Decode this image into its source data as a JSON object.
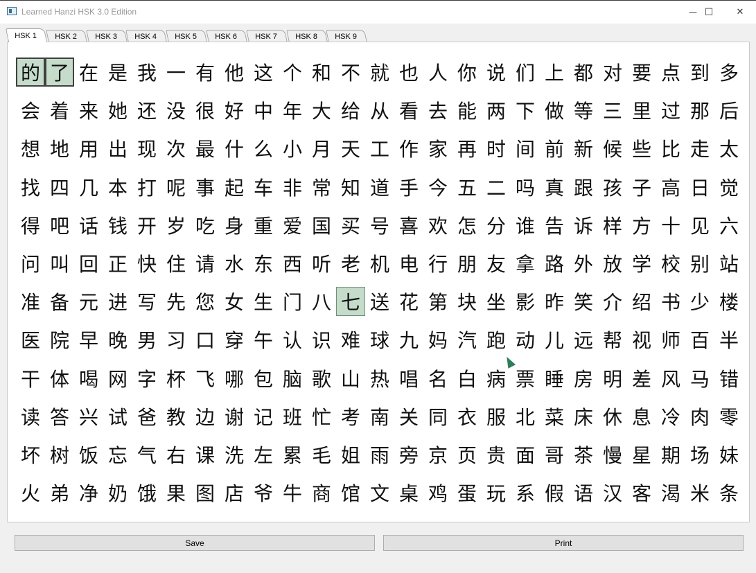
{
  "window": {
    "title": "Learned Hanzi HSK 3.0 Edition",
    "controls": {
      "minimize": "—",
      "maximize": "☐",
      "close": "✕"
    }
  },
  "tabs": [
    {
      "label": "HSK 1",
      "active": true
    },
    {
      "label": "HSK 2",
      "active": false
    },
    {
      "label": "HSK 3",
      "active": false
    },
    {
      "label": "HSK 4",
      "active": false
    },
    {
      "label": "HSK 5",
      "active": false
    },
    {
      "label": "HSK 6",
      "active": false
    },
    {
      "label": "HSK 7",
      "active": false
    },
    {
      "label": "HSK 8",
      "active": false
    },
    {
      "label": "HSK 9",
      "active": false
    }
  ],
  "hanzi_rows": [
    [
      "的",
      "了",
      "在",
      "是",
      "我",
      "一",
      "有",
      "他",
      "这",
      "个",
      "和",
      "不",
      "就",
      "也",
      "人",
      "你",
      "说",
      "们",
      "上",
      "都",
      "对",
      "要",
      "点",
      "到",
      "多"
    ],
    [
      "会",
      "着",
      "来",
      "她",
      "还",
      "没",
      "很",
      "好",
      "中",
      "年",
      "大",
      "给",
      "从",
      "看",
      "去",
      "能",
      "两",
      "下",
      "做",
      "等",
      "三",
      "里",
      "过",
      "那",
      "后"
    ],
    [
      "想",
      "地",
      "用",
      "出",
      "现",
      "次",
      "最",
      "什",
      "么",
      "小",
      "月",
      "天",
      "工",
      "作",
      "家",
      "再",
      "时",
      "间",
      "前",
      "新",
      "候",
      "些",
      "比",
      "走",
      "太"
    ],
    [
      "找",
      "四",
      "几",
      "本",
      "打",
      "呢",
      "事",
      "起",
      "车",
      "非",
      "常",
      "知",
      "道",
      "手",
      "今",
      "五",
      "二",
      "吗",
      "真",
      "跟",
      "孩",
      "子",
      "高",
      "日",
      "觉"
    ],
    [
      "得",
      "吧",
      "话",
      "钱",
      "开",
      "岁",
      "吃",
      "身",
      "重",
      "爱",
      "国",
      "买",
      "号",
      "喜",
      "欢",
      "怎",
      "分",
      "谁",
      "告",
      "诉",
      "样",
      "方",
      "十",
      "见",
      "六"
    ],
    [
      "问",
      "叫",
      "回",
      "正",
      "快",
      "住",
      "请",
      "水",
      "东",
      "西",
      "听",
      "老",
      "机",
      "电",
      "行",
      "朋",
      "友",
      "拿",
      "路",
      "外",
      "放",
      "学",
      "校",
      "别",
      "站"
    ],
    [
      "准",
      "备",
      "元",
      "进",
      "写",
      "先",
      "您",
      "女",
      "生",
      "门",
      "八",
      "七",
      "送",
      "花",
      "第",
      "块",
      "坐",
      "影",
      "昨",
      "笑",
      "介",
      "绍",
      "书",
      "少",
      "楼"
    ],
    [
      "医",
      "院",
      "早",
      "晚",
      "男",
      "习",
      "口",
      "穿",
      "午",
      "认",
      "识",
      "难",
      "球",
      "九",
      "妈",
      "汽",
      "跑",
      "动",
      "儿",
      "远",
      "帮",
      "视",
      "师",
      "百",
      "半"
    ],
    [
      "干",
      "体",
      "喝",
      "网",
      "字",
      "杯",
      "飞",
      "哪",
      "包",
      "脑",
      "歌",
      "山",
      "热",
      "唱",
      "名",
      "白",
      "病",
      "票",
      "睡",
      "房",
      "明",
      "差",
      "风",
      "马",
      "错"
    ],
    [
      "读",
      "答",
      "兴",
      "试",
      "爸",
      "教",
      "边",
      "谢",
      "记",
      "班",
      "忙",
      "考",
      "南",
      "关",
      "同",
      "衣",
      "服",
      "北",
      "菜",
      "床",
      "休",
      "息",
      "冷",
      "肉",
      "零"
    ],
    [
      "坏",
      "树",
      "饭",
      "忘",
      "气",
      "右",
      "课",
      "洗",
      "左",
      "累",
      "毛",
      "姐",
      "雨",
      "旁",
      "京",
      "页",
      "贵",
      "面",
      "哥",
      "茶",
      "慢",
      "星",
      "期",
      "场",
      "妹"
    ],
    [
      "火",
      "弟",
      "净",
      "奶",
      "饿",
      "果",
      "图",
      "店",
      "爷",
      "牛",
      "商",
      "馆",
      "文",
      "桌",
      "鸡",
      "蛋",
      "玩",
      "系",
      "假",
      "语",
      "汉",
      "客",
      "渴",
      "米",
      "条"
    ]
  ],
  "highlighted": [
    "的",
    "了",
    "七"
  ],
  "buttons": {
    "save": "Save",
    "print": "Print"
  },
  "colors": {
    "highlight": "#c6dccb",
    "accent": "#2e7d5b"
  }
}
